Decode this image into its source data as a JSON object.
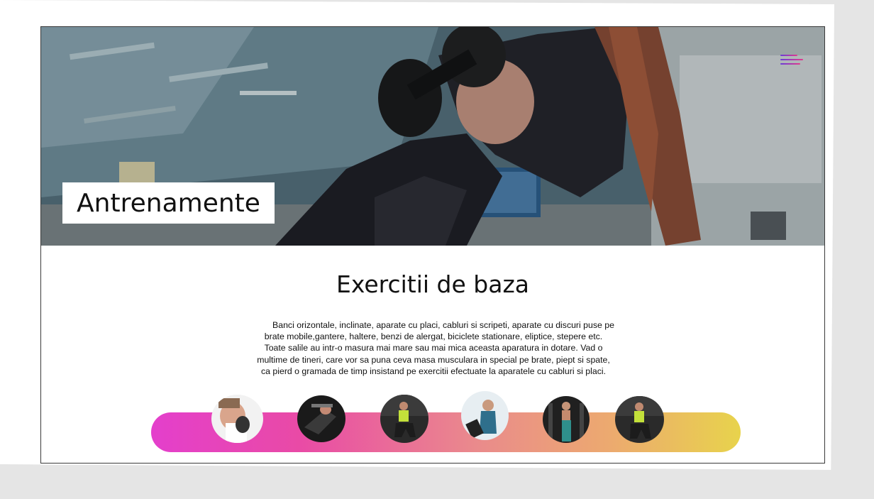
{
  "hero": {
    "title": "Antrenamente",
    "menu_icon": "hamburger-menu-icon"
  },
  "section": {
    "title": "Exercitii de baza",
    "lines": [
      "Banci orizontale, inclinate, aparate cu placi, cabluri si scripeti, aparate cu discuri puse pe",
      "brate mobile,gantere, haltere, benzi de alergat, biciclete stationare,   eliptice, stepere etc.",
      "Toate salile au intr-o masura mai mare sau mai mica aceasta aparatura in dotare. Vad o",
      "multime de tineri, care vor sa puna ceva masa musculara in special pe brate, piept si spate,",
      "ca pierd o gramada de timp insistand pe exercitii efectuate la aparatele cu cabluri si placi."
    ]
  },
  "gallery": {
    "items": [
      {
        "name": "thumb-dumbbell-curl"
      },
      {
        "name": "thumb-bench-press"
      },
      {
        "name": "thumb-squat"
      },
      {
        "name": "thumb-treadmill"
      },
      {
        "name": "thumb-cable-machine"
      },
      {
        "name": "thumb-squat-2"
      }
    ],
    "gradient": [
      "#e43fcc",
      "#e8d34c"
    ]
  }
}
